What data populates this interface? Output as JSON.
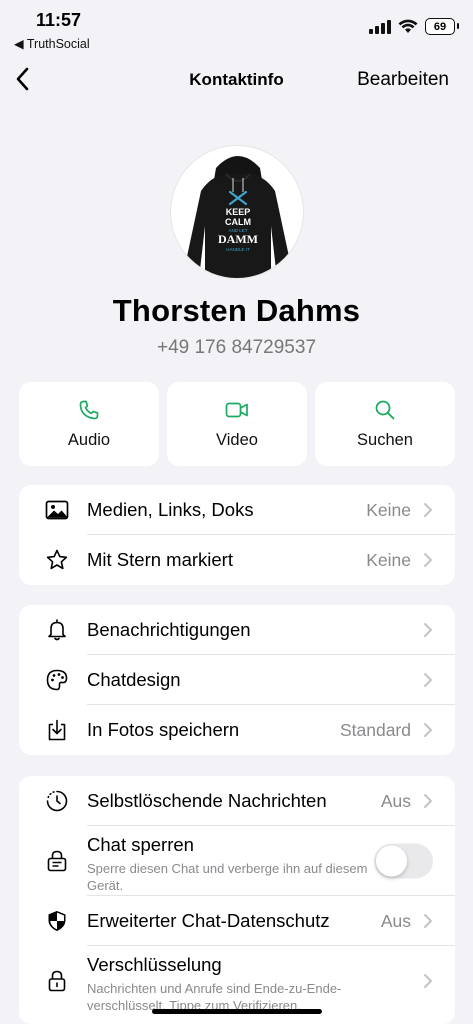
{
  "status": {
    "time": "11:57",
    "back_app": "◀ TruthSocial",
    "battery": "69"
  },
  "nav": {
    "title": "Kontaktinfo",
    "edit": "Bearbeiten"
  },
  "avatar": {
    "shirt_text": {
      "line1": "KEEP",
      "line2": "CALM",
      "line3": "AND LET",
      "line4": "DAMM",
      "line5": "HANDLE IT"
    }
  },
  "contact": {
    "name": "Thorsten Dahms",
    "phone": "+49 176 84729537"
  },
  "actions": [
    {
      "label": "Audio",
      "icon": "phone-icon"
    },
    {
      "label": "Video",
      "icon": "video-icon"
    },
    {
      "label": "Suchen",
      "icon": "search-icon"
    }
  ],
  "group1": [
    {
      "title": "Medien, Links, Doks",
      "value": "Keine",
      "icon": "image-icon"
    },
    {
      "title": "Mit Stern markiert",
      "value": "Keine",
      "icon": "star-icon"
    }
  ],
  "group2": [
    {
      "title": "Benachrichtigungen",
      "value": "",
      "icon": "bell-icon"
    },
    {
      "title": "Chatdesign",
      "value": "",
      "icon": "palette-icon"
    },
    {
      "title": "In Fotos speichern",
      "value": "Standard",
      "icon": "download-icon"
    }
  ],
  "group3": {
    "disappearing": {
      "title": "Selbstlöschende Nachrichten",
      "value": "Aus"
    },
    "lock": {
      "title": "Chat sperren",
      "sub": "Sperre diesen Chat und verberge ihn auf diesem Gerät.",
      "toggle_on": false
    },
    "privacy": {
      "title": "Erweiterter Chat-Datenschutz",
      "value": "Aus"
    },
    "encryption": {
      "title": "Verschlüsselung",
      "sub": "Nachrichten und Anrufe sind Ende-zu-Ende-verschlüsselt. Tippe zum Verifizieren."
    }
  },
  "colors": {
    "accent": "#1daa61",
    "background": "#f2f2f7",
    "secondary": "#8a8a8e"
  }
}
